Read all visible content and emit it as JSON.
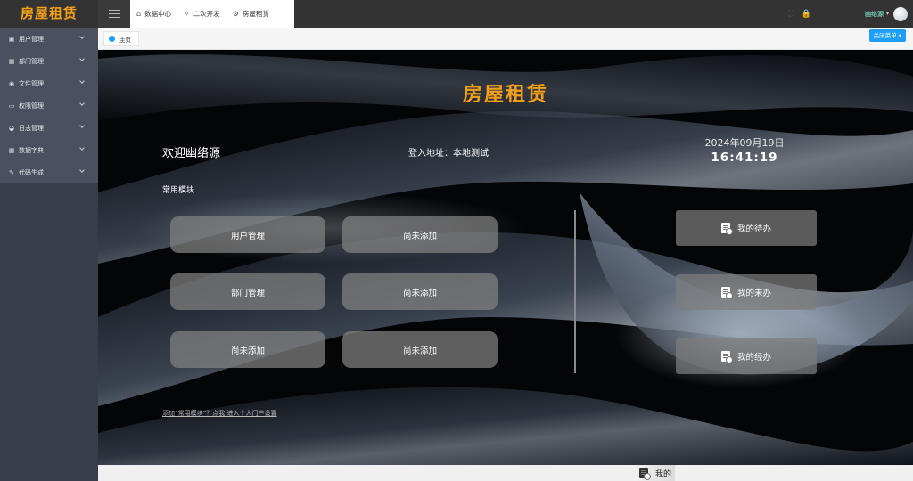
{
  "header": {
    "logo": "房屋租赁",
    "tabs": [
      {
        "icon": "home-icon",
        "glyph": "⌂",
        "label": "数据中心"
      },
      {
        "icon": "plugin-icon",
        "glyph": "✧",
        "label": "二次开发"
      },
      {
        "icon": "gear-icon",
        "glyph": "⚙",
        "label": "房屋租赁"
      }
    ],
    "user": {
      "name": "幽络源",
      "caret": "▾"
    },
    "icons": {
      "fullscreen": "⛶",
      "lock": "🔒"
    }
  },
  "sidebar": {
    "items": [
      {
        "icon": "users-icon",
        "glyph": "▣",
        "label": "用户管理"
      },
      {
        "icon": "grid-icon",
        "glyph": "▦",
        "label": "部门管理"
      },
      {
        "icon": "file-icon",
        "glyph": "◉",
        "label": "文件管理"
      },
      {
        "icon": "monitor-icon",
        "glyph": "▭",
        "label": "权限管理"
      },
      {
        "icon": "log-icon",
        "glyph": "◒",
        "label": "日志管理"
      },
      {
        "icon": "dict-icon",
        "glyph": "▦",
        "label": "数据字典"
      },
      {
        "icon": "code-icon",
        "glyph": "✎",
        "label": "代码生成"
      }
    ]
  },
  "breadcrumb": {
    "label": "主页"
  },
  "close_menu": "关闭菜单 ▾",
  "main": {
    "title": "房屋租赁",
    "welcome": "欢迎幽络源",
    "login_address": "登入地址：本地测试",
    "date": "2024年09月19日",
    "time": "16:41:19",
    "section_label": "常用模块",
    "modules": [
      "用户管理",
      "尚未添加",
      "部门管理",
      "尚未添加",
      "尚未添加",
      "尚未添加"
    ],
    "tasks": [
      "我的待办",
      "我的未办",
      "我的经办"
    ],
    "add_link": "添加“常用模块”？点我 进入个人门户设置",
    "ghost_task": "我的"
  },
  "colors": {
    "accent": "#f6a01a",
    "primary": "#1e9fff",
    "sidebar": "#393d49"
  }
}
